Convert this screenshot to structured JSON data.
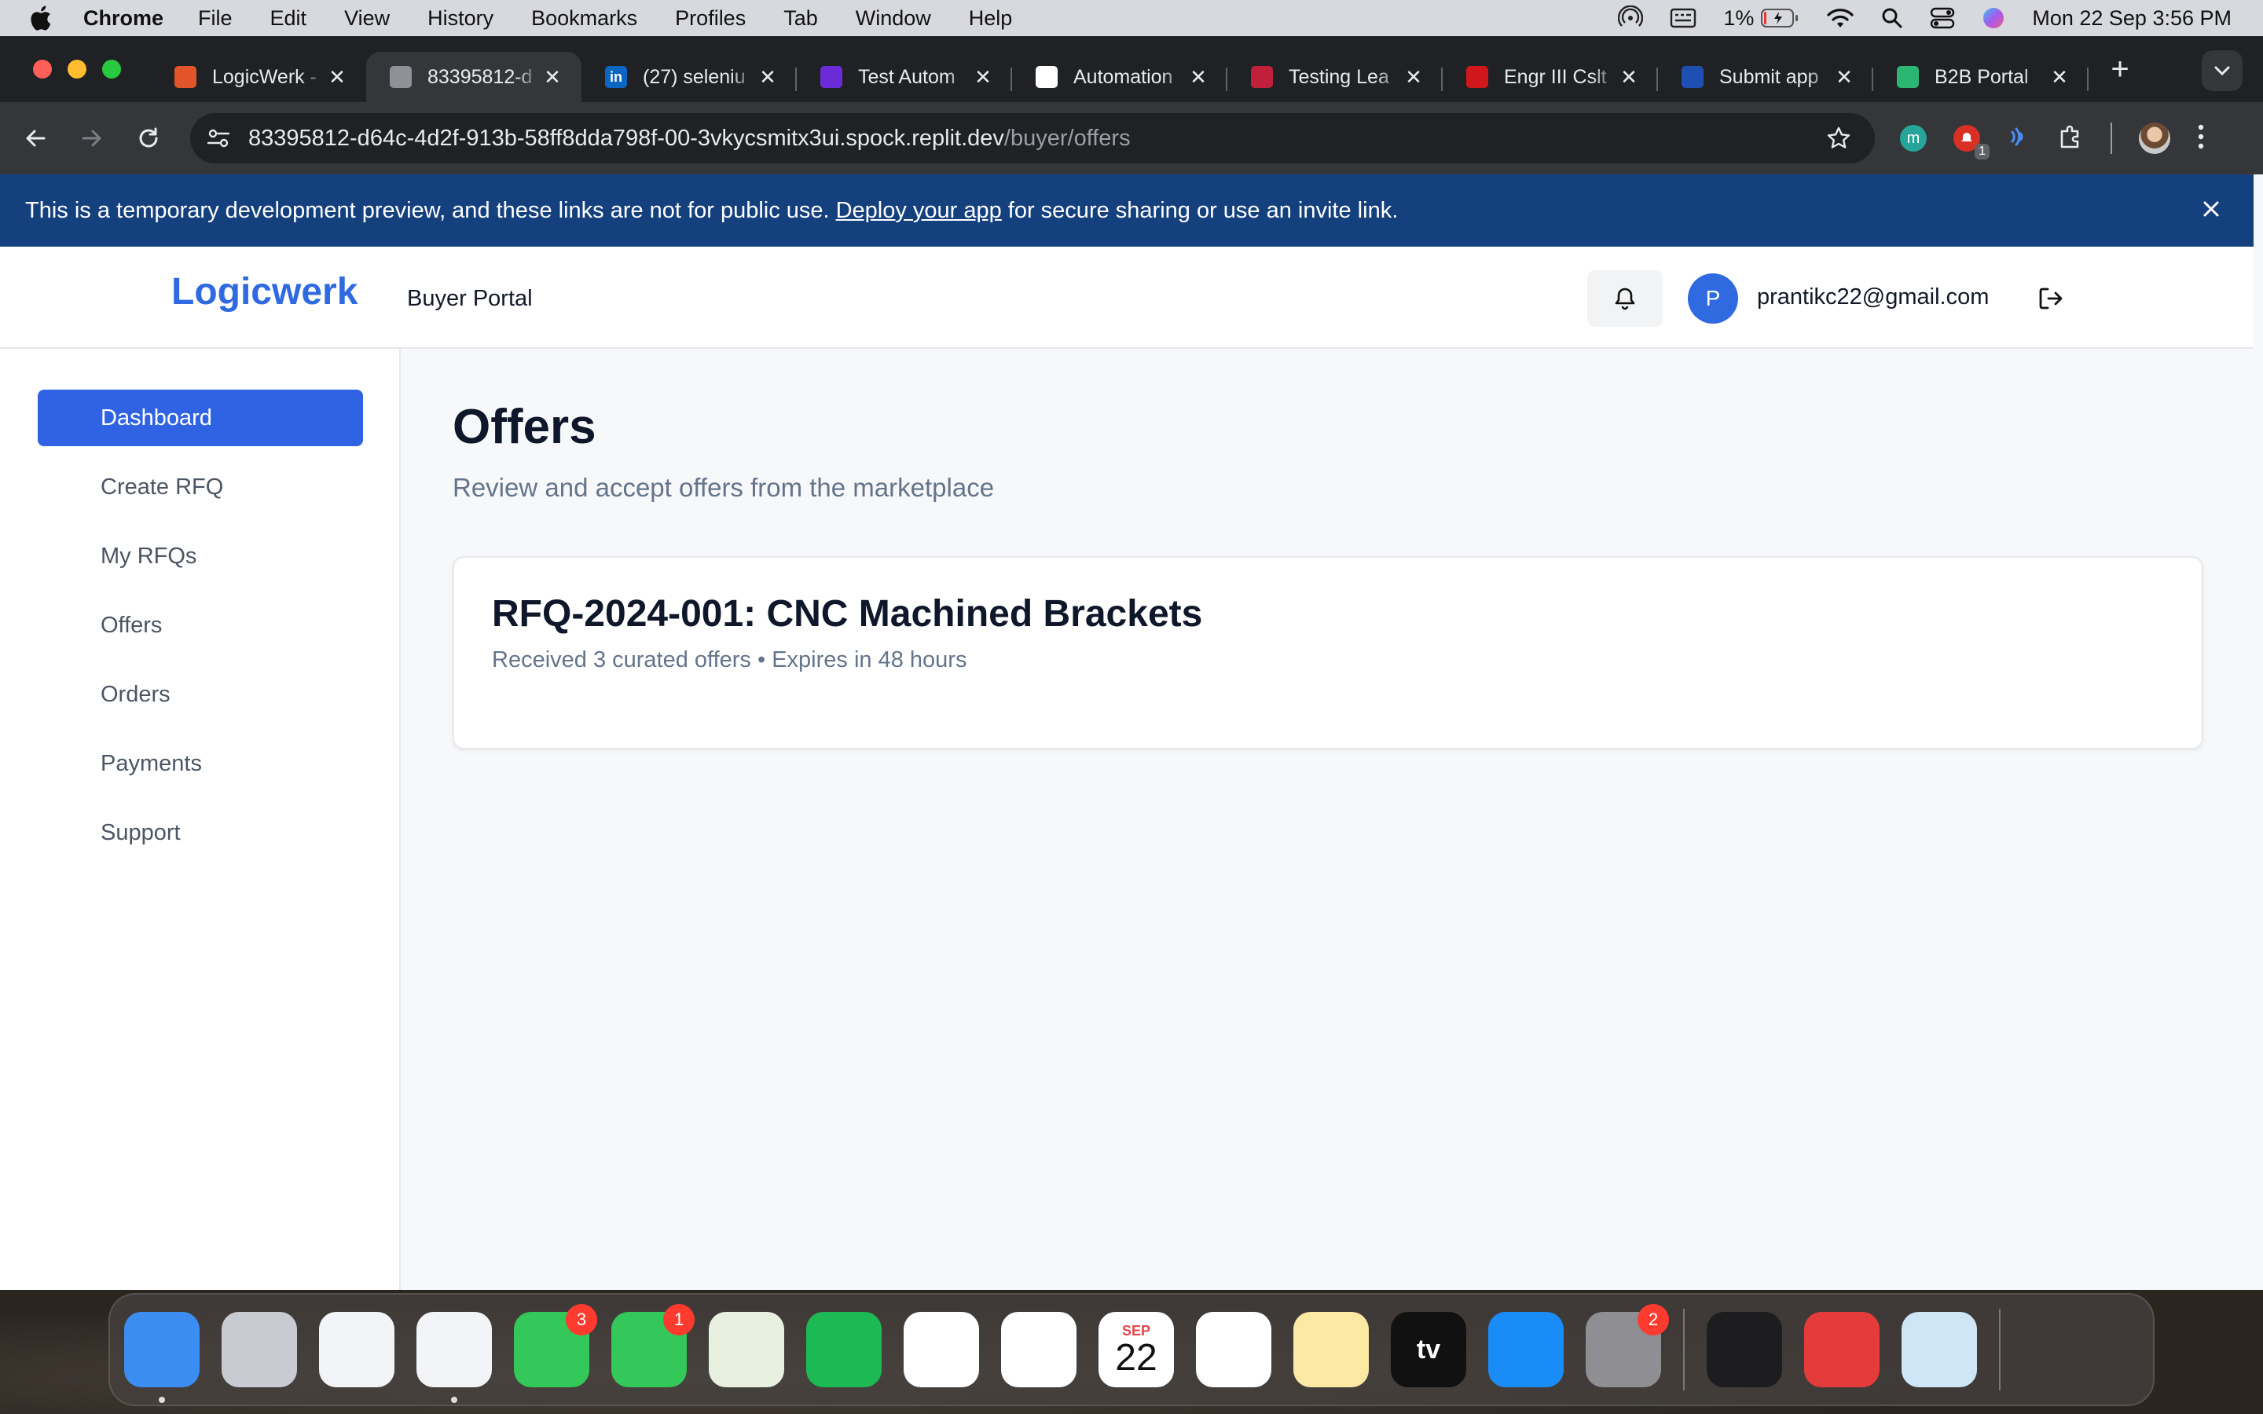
{
  "menubar": {
    "app_name": "Chrome",
    "menus": [
      "File",
      "Edit",
      "View",
      "History",
      "Bookmarks",
      "Profiles",
      "Tab",
      "Window",
      "Help"
    ],
    "battery": "1%",
    "datetime": "Mon 22 Sep  3:56 PM"
  },
  "tabs": [
    {
      "title": "LogicWerk -",
      "favicon_color": "#e2552a",
      "favicon": "logicwerk-icon"
    },
    {
      "title": "83395812-d",
      "favicon_color": "#8e9196",
      "favicon": "globe-icon",
      "active": true
    },
    {
      "title": "(27) seleniu",
      "favicon_color": "#0a66c2",
      "favicon": "linkedin-icon",
      "favicon_text": "in"
    },
    {
      "title": "Test Autom",
      "favicon_color": "#6c2bd9",
      "favicon": "test-automation-icon"
    },
    {
      "title": "Automation",
      "favicon_color": "#ffffff",
      "favicon": "automation-icon"
    },
    {
      "title": "Testing Lea",
      "favicon_color": "#c0203a",
      "favicon": "testing-learning-icon"
    },
    {
      "title": "Engr III Cslt",
      "favicon_color": "#d0171b",
      "favicon": "verizon-icon"
    },
    {
      "title": "Submit app",
      "favicon_color": "#1e50b4",
      "favicon": "submit-app-icon"
    },
    {
      "title": "B2B Portal",
      "favicon_color": "#2bb673",
      "favicon": "replit-agent-icon"
    }
  ],
  "tab_close_glyph": "✕",
  "address_bar": {
    "host": "83395812-d64c-4d2f-913b-58ff8dda798f-00-3vkycsmitx3ui.spock.replit.dev",
    "path": "/buyer/offers"
  },
  "extensions": {
    "badge": "1"
  },
  "dev_banner": {
    "text_before": "This is a temporary development preview, and these links are not for public use.",
    "link": "Deploy your app",
    "text_after": "for secure sharing or use an invite link."
  },
  "header": {
    "logo": "Logicwerk",
    "portal": "Buyer Portal",
    "avatar_initial": "P",
    "email": "prantikc22@gmail.com"
  },
  "sidebar": {
    "items": [
      {
        "label": "Dashboard",
        "active": true
      },
      {
        "label": "Create RFQ"
      },
      {
        "label": "My RFQs"
      },
      {
        "label": "Offers"
      },
      {
        "label": "Orders"
      },
      {
        "label": "Payments"
      },
      {
        "label": "Support"
      }
    ]
  },
  "main": {
    "title": "Offers",
    "subtitle": "Review and accept offers from the marketplace",
    "card": {
      "title": "RFQ-2024-001: CNC Machined Brackets",
      "meta": "Received 3 curated offers • Expires in 48 hours"
    }
  },
  "dock": {
    "items": [
      {
        "name": "finder",
        "bg": "#3b8df1",
        "running": true
      },
      {
        "name": "launchpad",
        "bg": "#c8cbd2"
      },
      {
        "name": "safari",
        "bg": "#f2f4f7"
      },
      {
        "name": "chrome",
        "bg": "#f2f4f7",
        "running": true
      },
      {
        "name": "facetime",
        "bg": "#34c759",
        "badge": "3"
      },
      {
        "name": "messages",
        "bg": "#34c759",
        "badge": "1"
      },
      {
        "name": "maps",
        "bg": "#e8f0e0"
      },
      {
        "name": "spotify",
        "bg": "#1db954"
      },
      {
        "name": "photos",
        "bg": "#ffffff"
      },
      {
        "name": "vscode",
        "bg": "#ffffff"
      },
      {
        "name": "calendar",
        "bg": "#ffffff",
        "month": "SEP",
        "day": "22"
      },
      {
        "name": "reminders",
        "bg": "#ffffff"
      },
      {
        "name": "notes",
        "bg": "#fbe9a4"
      },
      {
        "name": "apple-tv",
        "bg": "#111111",
        "label": "tv"
      },
      {
        "name": "app-store",
        "bg": "#1a8cf7"
      },
      {
        "name": "system-settings",
        "bg": "#8e8e93",
        "badge": "2"
      },
      {
        "name": "terminal",
        "bg": "#1d1d1f"
      },
      {
        "name": "wps-office",
        "bg": "#e43b3b"
      },
      {
        "name": "preview",
        "bg": "#cfe6f7"
      },
      {
        "name": "trash",
        "bg": "transparent"
      }
    ]
  }
}
